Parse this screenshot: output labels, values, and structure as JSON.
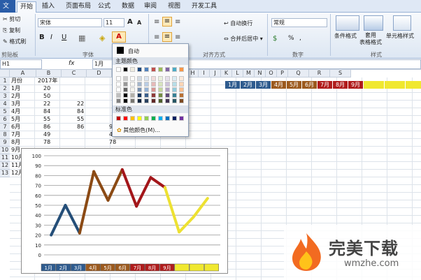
{
  "tabs": {
    "file": "文件",
    "items": [
      "开始",
      "插入",
      "页面布局",
      "公式",
      "数据",
      "审阅",
      "视图",
      "开发工具"
    ]
  },
  "clipboard": {
    "cut": "剪切",
    "copy": "复制",
    "format_painter": "格式刷",
    "group": "剪贴板"
  },
  "font": {
    "name": "宋体",
    "size": "11",
    "group": "字体",
    "grow": "A",
    "shrink": "A",
    "bold": "B",
    "italic": "I",
    "underline": "U"
  },
  "alignment": {
    "group": "对齐方式",
    "wrap": "自动换行",
    "merge": "合并后居中"
  },
  "number": {
    "group": "数字",
    "format": "常规",
    "percent": "%",
    "comma": ","
  },
  "styles": {
    "group": "样式",
    "conditional": "条件格式",
    "table": "套用\n表格格式",
    "cell_styles": "单元格样式"
  },
  "formula_bar": {
    "name_box": "H1",
    "fx": "fx",
    "content": "1月"
  },
  "columns": [
    "A",
    "B",
    "C",
    "D",
    "E",
    "F",
    "G",
    "H",
    "I",
    "J",
    "K",
    "L",
    "M",
    "N",
    "O",
    "P",
    "Q",
    "R",
    "S"
  ],
  "rows": [
    "1",
    "2",
    "3",
    "4",
    "5",
    "6",
    "7",
    "8",
    "9",
    "10",
    "11",
    "12",
    "13"
  ],
  "table": {
    "header": [
      "月份",
      "2017年"
    ],
    "months": [
      "1月",
      "2月",
      "3月",
      "4月",
      "5月",
      "6月",
      "7月",
      "8月",
      "9月",
      "10月",
      "11月",
      "12月"
    ],
    "col_b": [
      "20",
      "50",
      "22",
      "84",
      "55",
      "86",
      "49",
      "78"
    ],
    "col_c": [
      "",
      "",
      "22",
      "84",
      "55",
      "86",
      "",
      ""
    ],
    "col_d": [
      "",
      "",
      "",
      "",
      "",
      "9",
      "49",
      "78"
    ]
  },
  "month_row": {
    "labels": [
      "1月",
      "2月",
      "3月",
      "4月",
      "5月",
      "6月",
      "7月",
      "8月",
      "9月",
      "",
      "",
      ""
    ],
    "colors": [
      "#2e5b8e",
      "#2e5b8e",
      "#2e5b8e",
      "#9c5a1e",
      "#9c5a1e",
      "#9c5a1e",
      "#b01c1c",
      "#b01c1c",
      "#b01c1c",
      "#f0e830",
      "#f0e830",
      "#f0e830"
    ]
  },
  "color_picker": {
    "auto": "自动",
    "theme_label": "主题颜色",
    "standard_label": "标准色",
    "more": "其他颜色(M)...",
    "theme_top": [
      "#ffffff",
      "#000000",
      "#eeece1",
      "#1f497d",
      "#4f81bd",
      "#c0504d",
      "#9bbb59",
      "#8064a2",
      "#4bacc6",
      "#f79646"
    ],
    "standard": [
      "#c00000",
      "#ff0000",
      "#ffc000",
      "#ffff00",
      "#92d050",
      "#00b050",
      "#00b0f0",
      "#0070c0",
      "#002060",
      "#7030a0"
    ]
  },
  "chart_data": {
    "type": "line",
    "categories": [
      "1月",
      "2月",
      "3月",
      "4月",
      "5月",
      "6月",
      "7月",
      "8月",
      "9月",
      "10月",
      "11月",
      "12月"
    ],
    "values": [
      20,
      50,
      22,
      84,
      55,
      86,
      49,
      78,
      68,
      23,
      38,
      57
    ],
    "segment_colors": [
      "#244e78",
      "#244e78",
      "#8b4a14",
      "#8b4a14",
      "#8b4a14",
      "#a3161a",
      "#a3161a",
      "#a3161a",
      "#ede132",
      "#ede132",
      "#ede132"
    ],
    "ylim": [
      0,
      100
    ],
    "yticks": [
      "0",
      "10",
      "20",
      "30",
      "40",
      "50",
      "60",
      "70",
      "80",
      "90",
      "100"
    ],
    "grid": true,
    "axis_label_colors": [
      "#2e5b8e",
      "#2e5b8e",
      "#2e5b8e",
      "#9c5a1e",
      "#9c5a1e",
      "#9c5a1e",
      "#b01c1c",
      "#b01c1c",
      "#b01c1c",
      "#f0e830",
      "#f0e830",
      "#f0e830"
    ],
    "axis_labels": [
      "1月",
      "2月",
      "3月",
      "4月",
      "5月",
      "6月",
      "7月",
      "8月",
      "9月",
      "",
      "",
      ""
    ]
  },
  "watermark": {
    "brand": "完美下载",
    "url": "wmzhe.com"
  }
}
